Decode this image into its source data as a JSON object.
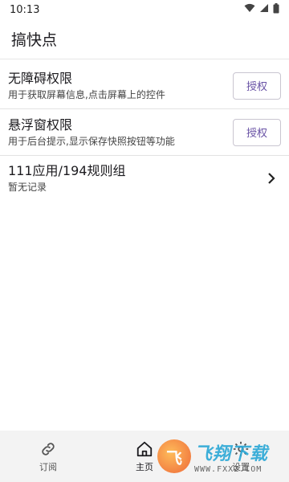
{
  "status_bar": {
    "time": "10:13",
    "icons": [
      "wifi-icon",
      "signal-icon",
      "battery-icon"
    ]
  },
  "app_bar": {
    "title": "搞快点"
  },
  "permissions": [
    {
      "title": "无障碍权限",
      "subtitle": "用于获取屏幕信息,点击屏幕上的控件",
      "button_label": "授权"
    },
    {
      "title": "悬浮窗权限",
      "subtitle": "用于后台提示,显示保存快照按钮等功能",
      "button_label": "授权"
    }
  ],
  "apps_row": {
    "title": "111应用/194规则组",
    "subtitle": "暂无记录",
    "icon": "chevron-right-icon"
  },
  "bottom_nav": {
    "items": [
      {
        "label": "订阅",
        "icon": "link-icon"
      },
      {
        "label": "主页",
        "icon": "home-icon"
      },
      {
        "label": "设置",
        "icon": "settings-icon"
      }
    ]
  },
  "watermark": {
    "logo_char": "飞",
    "main": "飞翔下载",
    "sub": "WWW.FXXZ.COM"
  },
  "colors": {
    "accent": "#6750a4",
    "divider": "#e2e2e2",
    "nav_bg": "#f3f3f3"
  }
}
